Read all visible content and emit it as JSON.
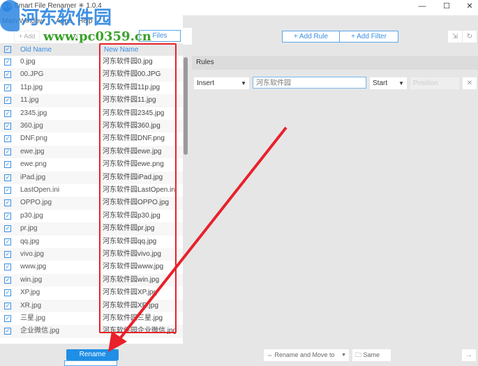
{
  "window": {
    "title": "Smart File Renamer ✳ 1.0.4",
    "app_icon": "AFR",
    "minimize": "—",
    "maximize": "☐",
    "close": "✕"
  },
  "menu": [
    "Main Window",
    "Apps",
    "Help"
  ],
  "toolbar": {
    "add": "+ Add",
    "clear": "X ...",
    "files": "Files",
    "add_rule": "+ Add Rule",
    "add_filter": "+ Add Filter"
  },
  "list": {
    "col_old": "Old Name",
    "col_new": "New Name",
    "rows": [
      {
        "old": "0.jpg",
        "new": "河东软件园0.jpg"
      },
      {
        "old": "00.JPG",
        "new": "河东软件园00.JPG"
      },
      {
        "old": "11p.jpg",
        "new": "河东软件园11p.jpg"
      },
      {
        "old": "11.jpg",
        "new": "河东软件园11.jpg"
      },
      {
        "old": "2345.jpg",
        "new": "河东软件园2345.jpg"
      },
      {
        "old": "360.jpg",
        "new": "河东软件园360.jpg"
      },
      {
        "old": "DNF.png",
        "new": "河东软件园DNF.png"
      },
      {
        "old": "ewe.jpg",
        "new": "河东软件园ewe.jpg"
      },
      {
        "old": "ewe.png",
        "new": "河东软件园ewe.png"
      },
      {
        "old": "iPad.jpg",
        "new": "河东软件园iPad.jpg"
      },
      {
        "old": "LastOpen.ini",
        "new": "河东软件园LastOpen.ini"
      },
      {
        "old": "OPPO.jpg",
        "new": "河东软件园OPPO.jpg"
      },
      {
        "old": "p30.jpg",
        "new": "河东软件园p30.jpg"
      },
      {
        "old": "pr.jpg",
        "new": "河东软件园pr.jpg"
      },
      {
        "old": "qq.jpg",
        "new": "河东软件园qq.jpg"
      },
      {
        "old": "vivo.jpg",
        "new": "河东软件园vivo.jpg"
      },
      {
        "old": "www.jpg",
        "new": "河东软件园www.jpg"
      },
      {
        "old": "win.jpg",
        "new": "河东软件园win.jpg"
      },
      {
        "old": "XP.jpg",
        "new": "河东软件园XP.jpg"
      },
      {
        "old": "XR.jpg",
        "new": "河东软件园XR.jpg"
      },
      {
        "old": "三星.jpg",
        "new": "河东软件园三星.jpg"
      },
      {
        "old": "企业微信.jpg",
        "new": "河东软件园企业微信.jpg"
      }
    ]
  },
  "rules": {
    "label": "Rules",
    "type": "Insert",
    "text": "河东软件园",
    "where": "Start",
    "position_placeholder": "Position",
    "remove": "✕"
  },
  "bottom": {
    "rename": "Rename",
    "move_option": "⇔ Rename and Move to",
    "folder": "Same",
    "go": "→"
  },
  "watermark": {
    "name": "河东软件园",
    "url": "www.pc0359.cn"
  }
}
